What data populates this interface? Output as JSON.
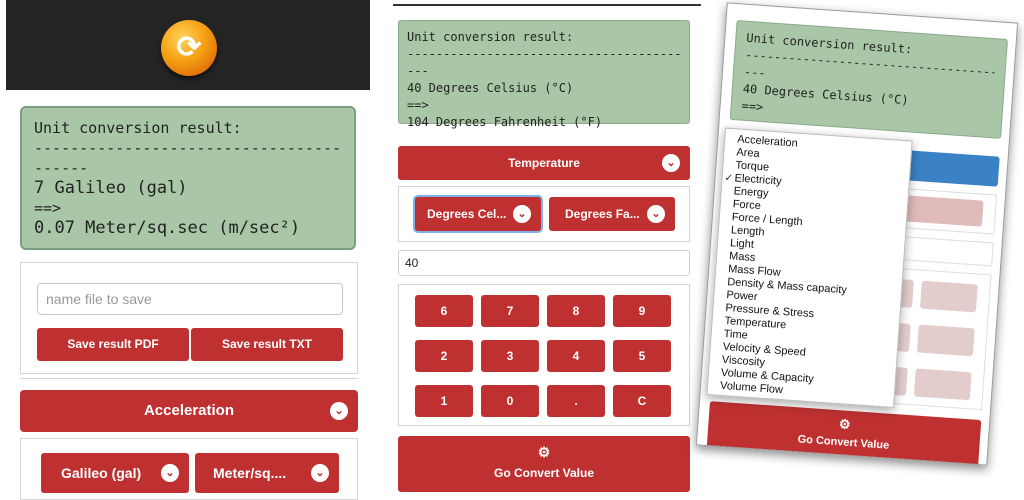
{
  "panel1": {
    "result": {
      "title": "Unit conversion result:",
      "dashes": "----------------------------------------------",
      "dashes2": "------",
      "from_value": "7 Galileo (gal)",
      "arrow": "==>",
      "to_value": "0.07 Meter/sq.sec (m/sec²)"
    },
    "save": {
      "placeholder": "name file to save",
      "pdf_label": "Save result PDF",
      "txt_label": "Save result TXT"
    },
    "category": "Acceleration",
    "unit_from": "Galileo (gal)",
    "unit_to": "Meter/sq...."
  },
  "panel2": {
    "result": {
      "title": "Unit conversion result:",
      "dashes": "-----------------------------------------",
      "dashes2": "---",
      "from_value": "40 Degrees Celsius (°C)",
      "arrow": "==>",
      "to_value": "104 Degrees Fahrenheit (°F)"
    },
    "category": "Temperature",
    "unit_from": "Degrees Cel...",
    "unit_to": "Degrees Fa...",
    "input_value": "40",
    "keypad": [
      [
        "6",
        "7",
        "8",
        "9"
      ],
      [
        "2",
        "3",
        "4",
        "5"
      ],
      [
        "1",
        "0",
        ".",
        "C"
      ]
    ],
    "convert_label": "Go Convert Value"
  },
  "panel3": {
    "result": {
      "title": "Unit conversion result:",
      "dashes": "-----------------------------------",
      "dashes2": "---",
      "from_value": "40 Degrees Celsius (°C)",
      "arrow": "==>"
    },
    "dropdown_options": [
      "Acceleration",
      "Area",
      "Torque",
      "Electricity",
      "Energy",
      "Force",
      "Force / Length",
      "Length",
      "Light",
      "Mass",
      "Mass Flow",
      "Density & Mass capacity",
      "Power",
      "Pressure & Stress",
      "Temperature",
      "Time",
      "Velocity & Speed",
      "Viscosity",
      "Volume & Capacity",
      "Volume Flow"
    ],
    "checked_option": "Electricity",
    "convert_label": "Go Convert Value"
  },
  "icons": {
    "refresh": "refresh-logo-icon",
    "chevron": "chevron-down-icon",
    "gear": "gear-icon",
    "check": "checkmark-icon"
  },
  "colors": {
    "accent_red": "#bf3131",
    "result_green": "#a9c7a7",
    "header_dark": "#242424"
  }
}
